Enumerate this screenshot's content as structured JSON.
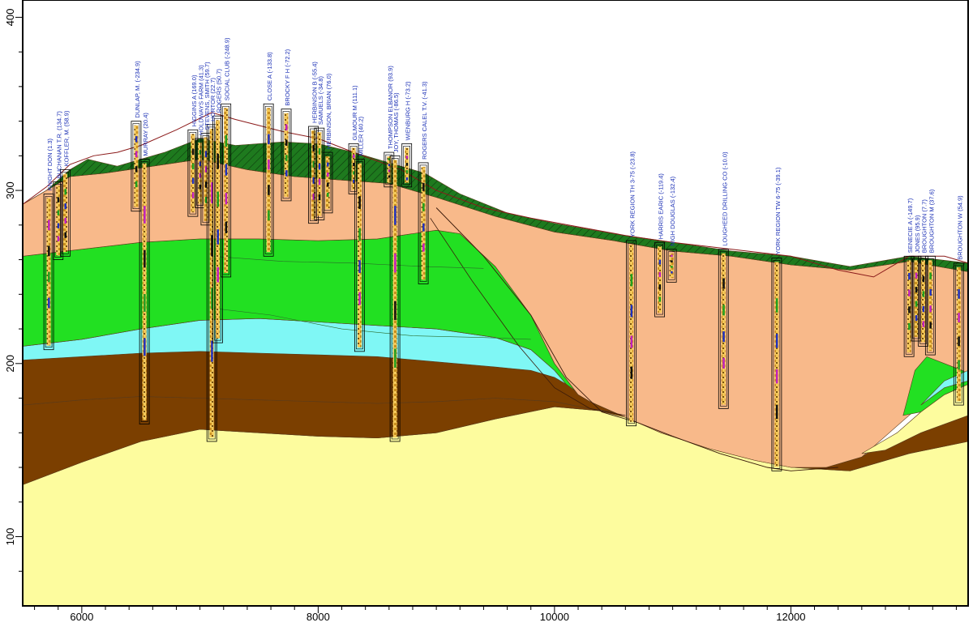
{
  "chart_data": {
    "type": "cross-section",
    "xlabel": "",
    "ylabel": "",
    "xlim": [
      5500,
      13500
    ],
    "ylim": [
      60,
      410
    ],
    "x_ticks": [
      "6000",
      "8000",
      "10000",
      "12000"
    ],
    "y_ticks": [
      "100",
      "200",
      "300",
      "400"
    ],
    "colors": {
      "topsoil": "#1e7a1e",
      "upper_sand": "#f8b98a",
      "green_unit": "#22e022",
      "cyan_unit": "#7ff7f5",
      "brown_unit": "#7b3f00",
      "yellow_unit": "#fdfc9e",
      "label": "#1a2fb5"
    },
    "wells": [
      {
        "label": "KNIGHT DON (1.3)",
        "x": 5720,
        "top": 298,
        "bottom": 208
      },
      {
        "label": "BUCHANAN T.R. (134.7)",
        "x": 5800,
        "top": 305,
        "bottom": 260
      },
      {
        "label": "KOFFLER, M. (58.9)",
        "x": 5860,
        "top": 312,
        "bottom": 262
      },
      {
        "label": "DUNLAP, M. (-234.9)",
        "x": 6460,
        "top": 340,
        "bottom": 288
      },
      {
        "label": "MURRAY (20.4)",
        "x": 6530,
        "top": 318,
        "bottom": 165
      },
      {
        "label": "HIGGINS A (169.0)",
        "x": 6940,
        "top": 335,
        "bottom": 285
      },
      {
        "label": "HOLDWAYS FARM (41.3)",
        "x": 7000,
        "top": 330,
        "bottom": 290
      },
      {
        "label": "STEVENS, SMITH (59.7)",
        "x": 7050,
        "top": 333,
        "bottom": 280
      },
      {
        "label": "HORTOR (22.7)",
        "x": 7100,
        "top": 338,
        "bottom": 155
      },
      {
        "label": "ROGERS (50.7)",
        "x": 7150,
        "top": 343,
        "bottom": 212
      },
      {
        "label": "SOCIAL CLUB (-248.9)",
        "x": 7220,
        "top": 350,
        "bottom": 250
      },
      {
        "label": "CLOSE A (-133.8)",
        "x": 7580,
        "top": 350,
        "bottom": 262
      },
      {
        "label": "BROCKY F H (-72.2)",
        "x": 7730,
        "top": 347,
        "bottom": 294
      },
      {
        "label": "HERBINSON B (-55.4)",
        "x": 7960,
        "top": 337,
        "bottom": 281
      },
      {
        "label": "SAMUELS (-34.8)",
        "x": 8010,
        "top": 336,
        "bottom": 283
      },
      {
        "label": "HERBINSON, BRIAN (76.0)",
        "x": 8080,
        "top": 322,
        "bottom": 287
      },
      {
        "label": "GILMOUR M (111.1)",
        "x": 8300,
        "top": 327,
        "bottom": 298
      },
      {
        "label": "MILLER (40.2)",
        "x": 8350,
        "top": 318,
        "bottom": 207
      },
      {
        "label": "THOMPSON ELBANOR (93.9)",
        "x": 8600,
        "top": 322,
        "bottom": 302
      },
      {
        "label": "JOY, THOMAS (-86.5)",
        "x": 8650,
        "top": 320,
        "bottom": 155
      },
      {
        "label": "WIENBURG H (-73.2)",
        "x": 8750,
        "top": 327,
        "bottom": 302
      },
      {
        "label": "ROGERS CALEL T.V. (-41.3)",
        "x": 8890,
        "top": 316,
        "bottom": 246
      },
      {
        "label": "YORK REGION TH 3-75 (-23.8)",
        "x": 10650,
        "top": 271,
        "bottom": 164
      },
      {
        "label": "HARRIS EARIC (-119.4)",
        "x": 10890,
        "top": 270,
        "bottom": 227
      },
      {
        "label": "NIGH DOUGLAS (-132.4)",
        "x": 10990,
        "top": 266,
        "bottom": 247
      },
      {
        "label": "LOUGHEED DRILLING CO (-10.0)",
        "x": 11430,
        "top": 266,
        "bottom": 174
      },
      {
        "label": "YORK REGION TW 6-75 (-39.1)",
        "x": 11880,
        "top": 261,
        "bottom": 138
      },
      {
        "label": "SENECIE A (-149.7)",
        "x": 13000,
        "top": 262,
        "bottom": 204
      },
      {
        "label": "JONES (95.9)",
        "x": 13060,
        "top": 262,
        "bottom": 213
      },
      {
        "label": "BROUGHTON (7.7)",
        "x": 13120,
        "top": 262,
        "bottom": 210
      },
      {
        "label": "BROUGHTON M (37.6)",
        "x": 13180,
        "top": 262,
        "bottom": 205
      },
      {
        "label": "BROUGHTON W (54.9)",
        "x": 13420,
        "top": 258,
        "bottom": 176
      }
    ]
  }
}
